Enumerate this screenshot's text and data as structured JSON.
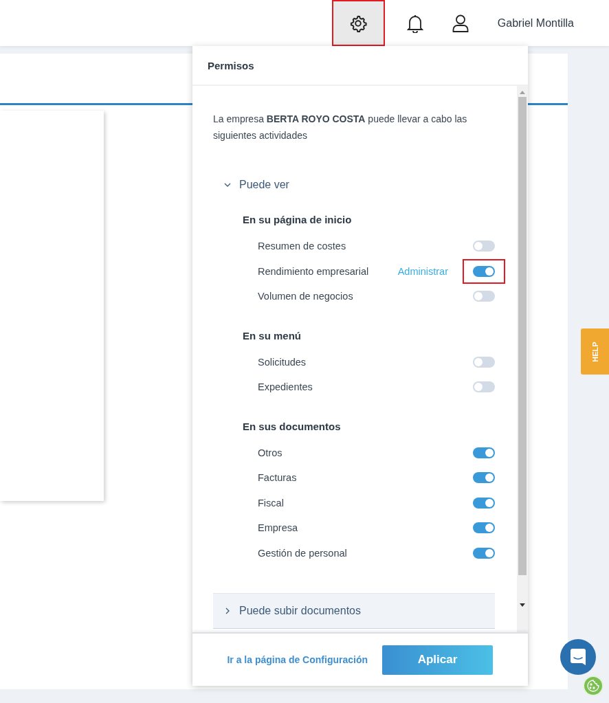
{
  "header": {
    "settings_highlighted": true,
    "user_name": "Gabriel Montilla"
  },
  "permissions_panel": {
    "title": "Permisos",
    "intro": "La empresa **BERTA ROYO COSTA** puede llevar a cabo las siguientes actividades",
    "sections": [
      {
        "label": "Puede ver",
        "expanded": true,
        "groups": [
          {
            "heading": "En su página de inicio",
            "items": [
              {
                "label": "Resumen de costes",
                "on": false,
                "highlighted": false
              },
              {
                "label": "Rendimiento empresarial",
                "on": true,
                "highlighted": true,
                "link": "Administrar"
              },
              {
                "label": "Volumen de negocios",
                "on": false,
                "highlighted": false
              }
            ]
          },
          {
            "heading": "En su menú",
            "items": [
              {
                "label": "Solicitudes",
                "on": false,
                "highlighted": false
              },
              {
                "label": "Expedientes",
                "on": false,
                "highlighted": false
              }
            ]
          },
          {
            "heading": "En sus documentos",
            "items": [
              {
                "label": "Otros",
                "on": true,
                "highlighted": false
              },
              {
                "label": "Facturas",
                "on": true,
                "highlighted": false
              },
              {
                "label": "Fiscal",
                "on": true,
                "highlighted": false
              },
              {
                "label": "Empresa",
                "on": true,
                "highlighted": false
              },
              {
                "label": "Gestión de personal",
                "on": true,
                "highlighted": false
              }
            ]
          }
        ]
      },
      {
        "label": "Puede subir documentos",
        "expanded": false
      }
    ],
    "footer_link": "Ir a la página de Configuración",
    "apply_button": "Aplicar"
  },
  "help_tab": "HELP"
}
